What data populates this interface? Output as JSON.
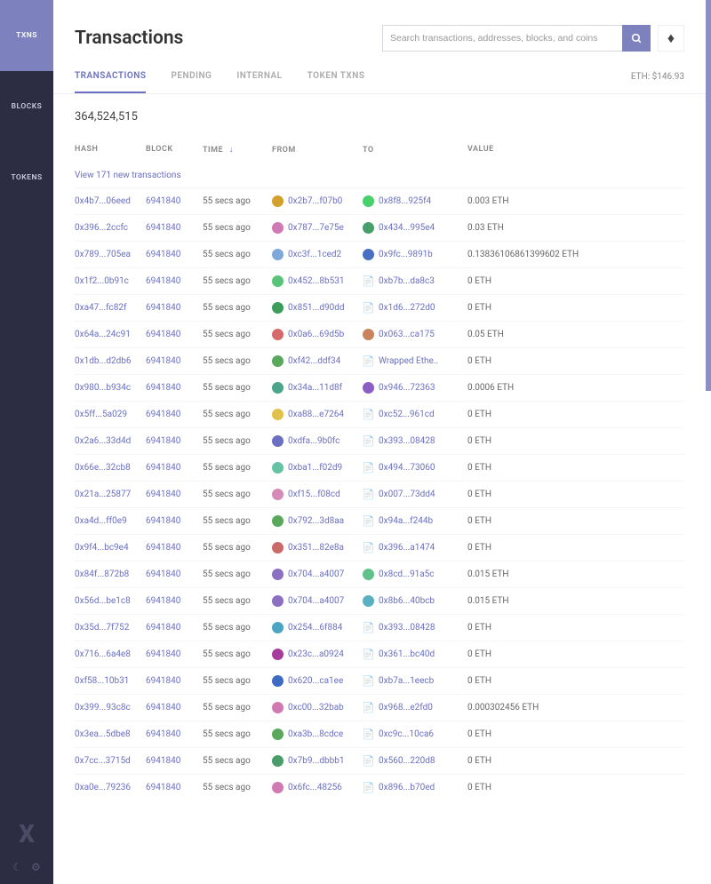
{
  "sidebar": {
    "items": [
      {
        "label": "TXNS"
      },
      {
        "label": "BLOCKS"
      },
      {
        "label": "TOKENS"
      }
    ],
    "logo": "X"
  },
  "header": {
    "title": "Transactions",
    "search_placeholder": "Search transactions, addresses, blocks, and coins"
  },
  "tabs": [
    {
      "label": "TRANSACTIONS"
    },
    {
      "label": "PENDING"
    },
    {
      "label": "INTERNAL"
    },
    {
      "label": "TOKEN TXNS"
    }
  ],
  "eth_price": "ETH: $146.93",
  "total_count": "364,524,515",
  "columns": {
    "hash": "HASH",
    "block": "BLOCK",
    "time": "TIME",
    "from": "FROM",
    "to": "TO",
    "value": "VALUE"
  },
  "new_transactions": "View 171 new transactions",
  "rows": [
    {
      "hash": "0x4b7...06eed",
      "block": "6941840",
      "time": "55 secs ago",
      "from": "0x2b7...f07b0",
      "from_color": "#d3a12b",
      "to": "0x8f8...925f4",
      "to_color": "#48d06b",
      "to_kind": "addr",
      "value": "0.003 ETH"
    },
    {
      "hash": "0x396...2ccfc",
      "block": "6941840",
      "time": "55 secs ago",
      "from": "0x787...7e75e",
      "from_color": "#d07ab3",
      "to": "0x434...995e4",
      "to_color": "#47a06b",
      "to_kind": "addr",
      "value": "0.03 ETH"
    },
    {
      "hash": "0x789...705ea",
      "block": "6941840",
      "time": "55 secs ago",
      "from": "0xc3f...1ced2",
      "from_color": "#7ea8d8",
      "to": "0x9fc...9891b",
      "to_color": "#4a6fc2",
      "to_kind": "addr",
      "value": "0.13836106861399602 ETH"
    },
    {
      "hash": "0x1f2...0b91c",
      "block": "6941840",
      "time": "55 secs ago",
      "from": "0x452...8b531",
      "from_color": "#58c47a",
      "to": "0xb7b...da8c3",
      "to_kind": "doc",
      "value": "0 ETH"
    },
    {
      "hash": "0xa47...fc82f",
      "block": "6941840",
      "time": "55 secs ago",
      "from": "0x851...d90dd",
      "from_color": "#3c9c5a",
      "to": "0x1d6...272d0",
      "to_kind": "doc",
      "value": "0 ETH"
    },
    {
      "hash": "0x64a...24c91",
      "block": "6941840",
      "time": "55 secs ago",
      "from": "0x0a6...69d5b",
      "from_color": "#d56a6a",
      "to": "0x063...ca175",
      "to_color": "#c9845e",
      "to_kind": "addr",
      "value": "0.05 ETH"
    },
    {
      "hash": "0x1db...d2db6",
      "block": "6941840",
      "time": "55 secs ago",
      "from": "0xf42...ddf34",
      "from_color": "#5aa85c",
      "to": "Wrapped Ethe..",
      "to_kind": "doc",
      "value": "0 ETH"
    },
    {
      "hash": "0x980...b934c",
      "block": "6941840",
      "time": "55 secs ago",
      "from": "0x34a...11d8f",
      "from_color": "#4aa58a",
      "to": "0x946...72363",
      "to_color": "#8a5ec2",
      "to_kind": "addr",
      "value": "0.0006 ETH"
    },
    {
      "hash": "0x5ff...5a029",
      "block": "6941840",
      "time": "55 secs ago",
      "from": "0xa88...e7264",
      "from_color": "#e0c24a",
      "to": "0xc52...961cd",
      "to_kind": "doc",
      "value": "0 ETH"
    },
    {
      "hash": "0x2a6...33d4d",
      "block": "6941840",
      "time": "55 secs ago",
      "from": "0xdfa...9b0fc",
      "from_color": "#6a6fc2",
      "to": "0x393...08428",
      "to_kind": "doc",
      "value": "0 ETH"
    },
    {
      "hash": "0x66e...32cb8",
      "block": "6941840",
      "time": "55 secs ago",
      "from": "0xba1...f02d9",
      "from_color": "#66c2a5",
      "to": "0x494...73060",
      "to_kind": "doc",
      "value": "0 ETH"
    },
    {
      "hash": "0x21a...25877",
      "block": "6941840",
      "time": "55 secs ago",
      "from": "0xf15...f08cd",
      "from_color": "#d58ab8",
      "to": "0x007...73dd4",
      "to_kind": "doc",
      "value": "0 ETH"
    },
    {
      "hash": "0xa4d...ff0e9",
      "block": "6941840",
      "time": "55 secs ago",
      "from": "0x792...3d8aa",
      "from_color": "#5aa85c",
      "to": "0x94a...f244b",
      "to_kind": "doc",
      "value": "0 ETH"
    },
    {
      "hash": "0x9f4...bc9e4",
      "block": "6941840",
      "time": "55 secs ago",
      "from": "0x351...82e8a",
      "from_color": "#c96a6a",
      "to": "0x396...a1474",
      "to_kind": "doc",
      "value": "0 ETH"
    },
    {
      "hash": "0x84f...872b8",
      "block": "6941840",
      "time": "55 secs ago",
      "from": "0x704...a4007",
      "from_color": "#8a6fc2",
      "to": "0x8cd...91a5c",
      "to_color": "#60c28a",
      "to_kind": "addr",
      "value": "0.015 ETH"
    },
    {
      "hash": "0x56d...be1c8",
      "block": "6941840",
      "time": "55 secs ago",
      "from": "0x704...a4007",
      "from_color": "#8a6fc2",
      "to": "0x8b6...40bcb",
      "to_color": "#5ab0c2",
      "to_kind": "addr",
      "value": "0.015 ETH"
    },
    {
      "hash": "0x35d...7f752",
      "block": "6941840",
      "time": "55 secs ago",
      "from": "0x254...6f884",
      "from_color": "#4aa5c2",
      "to": "0x393...08428",
      "to_kind": "doc",
      "value": "0 ETH"
    },
    {
      "hash": "0x716...6a4e8",
      "block": "6941840",
      "time": "55 secs ago",
      "from": "0x23c...a0924",
      "from_color": "#a63d9c",
      "to": "0x361...bc40d",
      "to_kind": "doc",
      "value": "0 ETH"
    },
    {
      "hash": "0xf58...10b31",
      "block": "6941840",
      "time": "55 secs ago",
      "from": "0x620...ca1ee",
      "from_color": "#3d6ac2",
      "to": "0xb7a...1eecb",
      "to_kind": "doc",
      "value": "0 ETH"
    },
    {
      "hash": "0x399...93c8c",
      "block": "6941840",
      "time": "55 secs ago",
      "from": "0xc00...32bab",
      "from_color": "#d07ab3",
      "to": "0x968...e2fd0",
      "to_kind": "doc",
      "value": "0.000302456 ETH"
    },
    {
      "hash": "0x3ea...5dbe8",
      "block": "6941840",
      "time": "55 secs ago",
      "from": "0xa3b...8cdce",
      "from_color": "#5aa85c",
      "to": "0xc9c...10ca6",
      "to_kind": "doc",
      "value": "0 ETH"
    },
    {
      "hash": "0x7cc...3715d",
      "block": "6941840",
      "time": "55 secs ago",
      "from": "0x7b9...dbbb1",
      "from_color": "#4a9c6a",
      "to": "0x560...220d8",
      "to_kind": "doc",
      "value": "0 ETH"
    },
    {
      "hash": "0xa0e...79236",
      "block": "6941840",
      "time": "55 secs ago",
      "from": "0x6fc...48256",
      "from_color": "#d07ab3",
      "to": "0x896...b70ed",
      "to_kind": "doc",
      "value": "0 ETH"
    }
  ]
}
